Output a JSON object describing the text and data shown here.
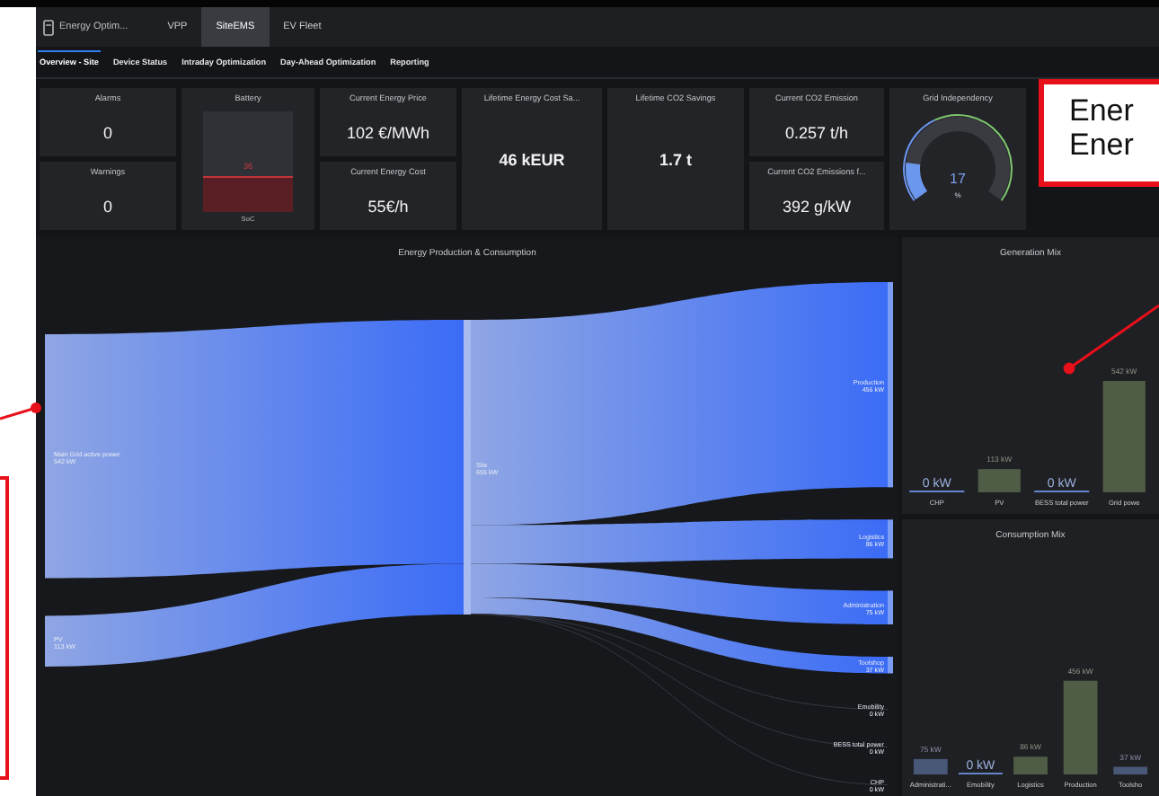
{
  "app": {
    "title": "Energy Optim...",
    "tabs": [
      {
        "label": "VPP",
        "selected": false
      },
      {
        "label": "SiteEMS",
        "selected": true
      },
      {
        "label": "EV Fleet",
        "selected": false
      }
    ]
  },
  "subtabs": [
    {
      "label": "Overview - Site",
      "selected": true
    },
    {
      "label": "Device Status",
      "selected": false
    },
    {
      "label": "Intraday Optimization",
      "selected": false
    },
    {
      "label": "Day-Ahead Optimization",
      "selected": false
    },
    {
      "label": "Reporting",
      "selected": false
    }
  ],
  "kpi_columns": [
    {
      "kind": "stack",
      "cards": [
        {
          "label": "Alarms",
          "value": "0"
        },
        {
          "label": "Warnings",
          "value": "0"
        }
      ]
    },
    {
      "kind": "battery",
      "label": "Battery",
      "reading": "36",
      "level": 0.36,
      "caption": "SoC"
    },
    {
      "kind": "stack",
      "cards": [
        {
          "label": "Current Energy Price",
          "value": "102 €/MWh"
        },
        {
          "label": "Current Energy Cost",
          "value": "55€/h"
        }
      ]
    },
    {
      "kind": "tall",
      "label": "Lifetime Energy Cost Sa...",
      "value": "46 kEUR"
    },
    {
      "kind": "tall",
      "label": "Lifetime CO2 Savings",
      "value": "1.7 t"
    },
    {
      "kind": "stack",
      "cards": [
        {
          "label": "Current CO2 Emission",
          "value": "0.257 t/h"
        },
        {
          "label": "Current CO2 Emissions f...",
          "value": "392 g/kW"
        }
      ]
    },
    {
      "kind": "gauge",
      "label": "Grid Independency",
      "reading": "17",
      "unit": "%",
      "level": 0.17
    }
  ],
  "sankey": {
    "title": "Energy Production & Consumption",
    "sources": [
      {
        "label": "Main Grid active power",
        "value": "542 kW"
      },
      {
        "label": "PV",
        "value": "113 kW"
      }
    ],
    "hub": {
      "label": "Site",
      "value": "655 kW"
    },
    "sinks": [
      {
        "label": "Production",
        "value": "456 kW"
      },
      {
        "label": "Logistics",
        "value": "86 kW"
      },
      {
        "label": "Administration",
        "value": "75 kW"
      },
      {
        "label": "Toolshop",
        "value": "37 kW"
      },
      {
        "label": "Emobility",
        "value": "0 kW"
      },
      {
        "label": "BESS total power",
        "value": "0 kW"
      },
      {
        "label": "CHP",
        "value": "0 kW"
      }
    ]
  },
  "generation_mix": {
    "chart_data": {
      "type": "bar",
      "title": "Generation Mix",
      "categories": [
        "CHP",
        "PV",
        "BESS total power",
        "Grid powe"
      ],
      "series": [
        {
          "color": "#4f5d46",
          "values": [
            null,
            113,
            null,
            542
          ],
          "value_labels": [
            null,
            "113 kW",
            null,
            "542 kW"
          ]
        },
        {
          "color": "#6485c9",
          "values": [
            0,
            null,
            0,
            null
          ],
          "value_labels": [
            "0 kW",
            null,
            "0 kW",
            null
          ]
        }
      ]
    }
  },
  "consumption_mix": {
    "chart_data": {
      "type": "bar",
      "title": "Consumption Mix",
      "categories": [
        "Administrati...",
        "Emobility",
        "Logistics",
        "Production",
        "Toolsho"
      ],
      "series": [
        {
          "color": "#4f5d46",
          "values": [
            null,
            null,
            86,
            456,
            null
          ],
          "value_labels": [
            null,
            null,
            "86 kW",
            "456 kW",
            null
          ]
        },
        {
          "color": "#4a5878",
          "values": [
            75,
            null,
            null,
            null,
            37
          ],
          "value_labels": [
            "75 kW",
            null,
            null,
            null,
            "37 kW"
          ]
        },
        {
          "color": "#6485c9",
          "values": [
            null,
            0,
            null,
            null,
            null
          ],
          "value_labels": [
            null,
            "0 kW",
            null,
            null,
            null
          ]
        }
      ]
    }
  },
  "annotation": {
    "callout_lines": [
      "Ener",
      "Ener"
    ]
  }
}
